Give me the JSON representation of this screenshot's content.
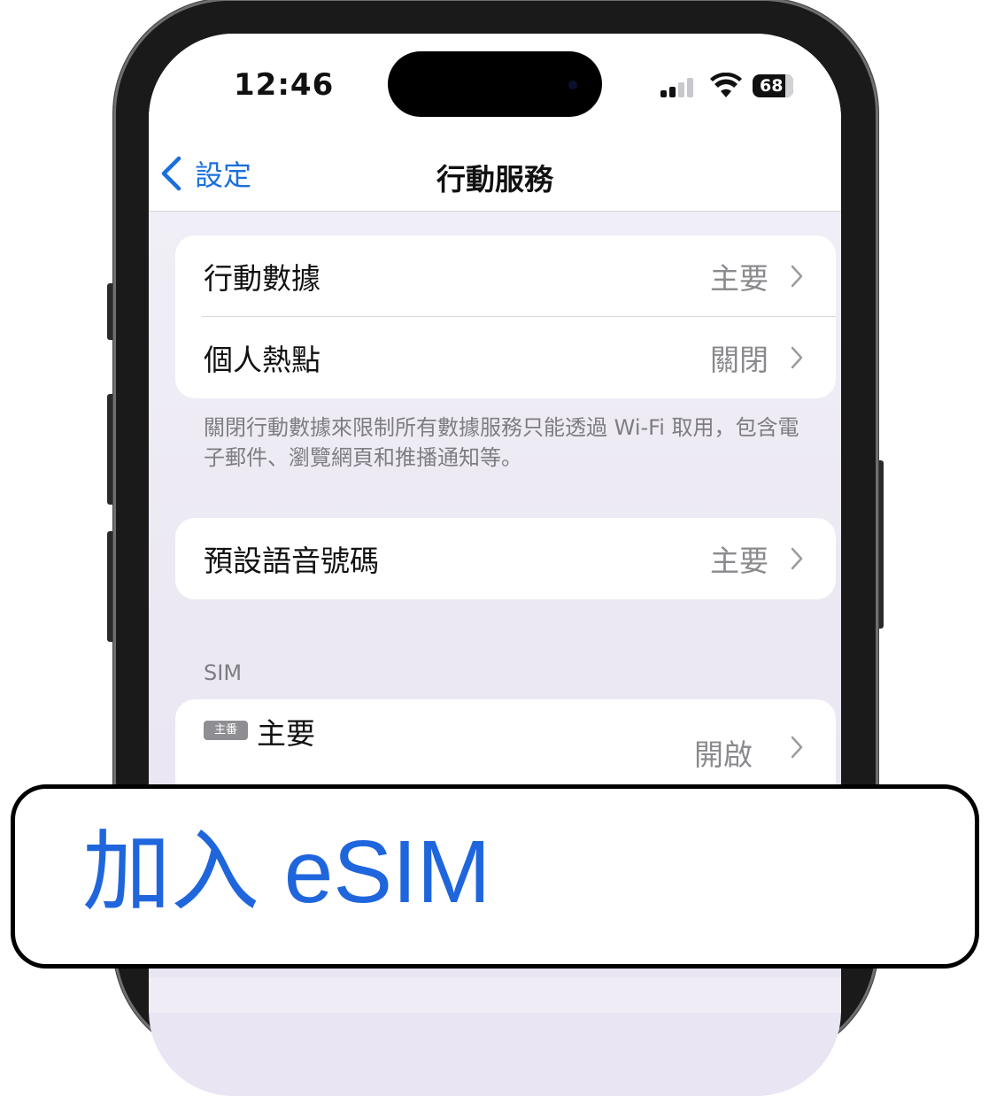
{
  "status_bar": {
    "time": "12:46",
    "battery": "68"
  },
  "nav": {
    "back_label": "設定",
    "title": "行動服務"
  },
  "group1": {
    "rows": [
      {
        "label": "行動數據",
        "value": "主要"
      },
      {
        "label": "個人熱點",
        "value": "關閉"
      }
    ]
  },
  "footer_note": "關閉行動數據來限制所有數據服務只能透過 Wi-Fi 取用，包含電子郵件、瀏覽網頁和推播通知等。",
  "group2": {
    "rows": [
      {
        "label": "預設語音號碼",
        "value": "主要"
      }
    ]
  },
  "sim_section": {
    "header": "SIM",
    "badge": "主番",
    "label": "主要",
    "value": "開啟"
  },
  "callout": {
    "text": "加入 eSIM"
  },
  "colors": {
    "accent": "#1a6fdc",
    "callout_text": "#1f66dd"
  }
}
